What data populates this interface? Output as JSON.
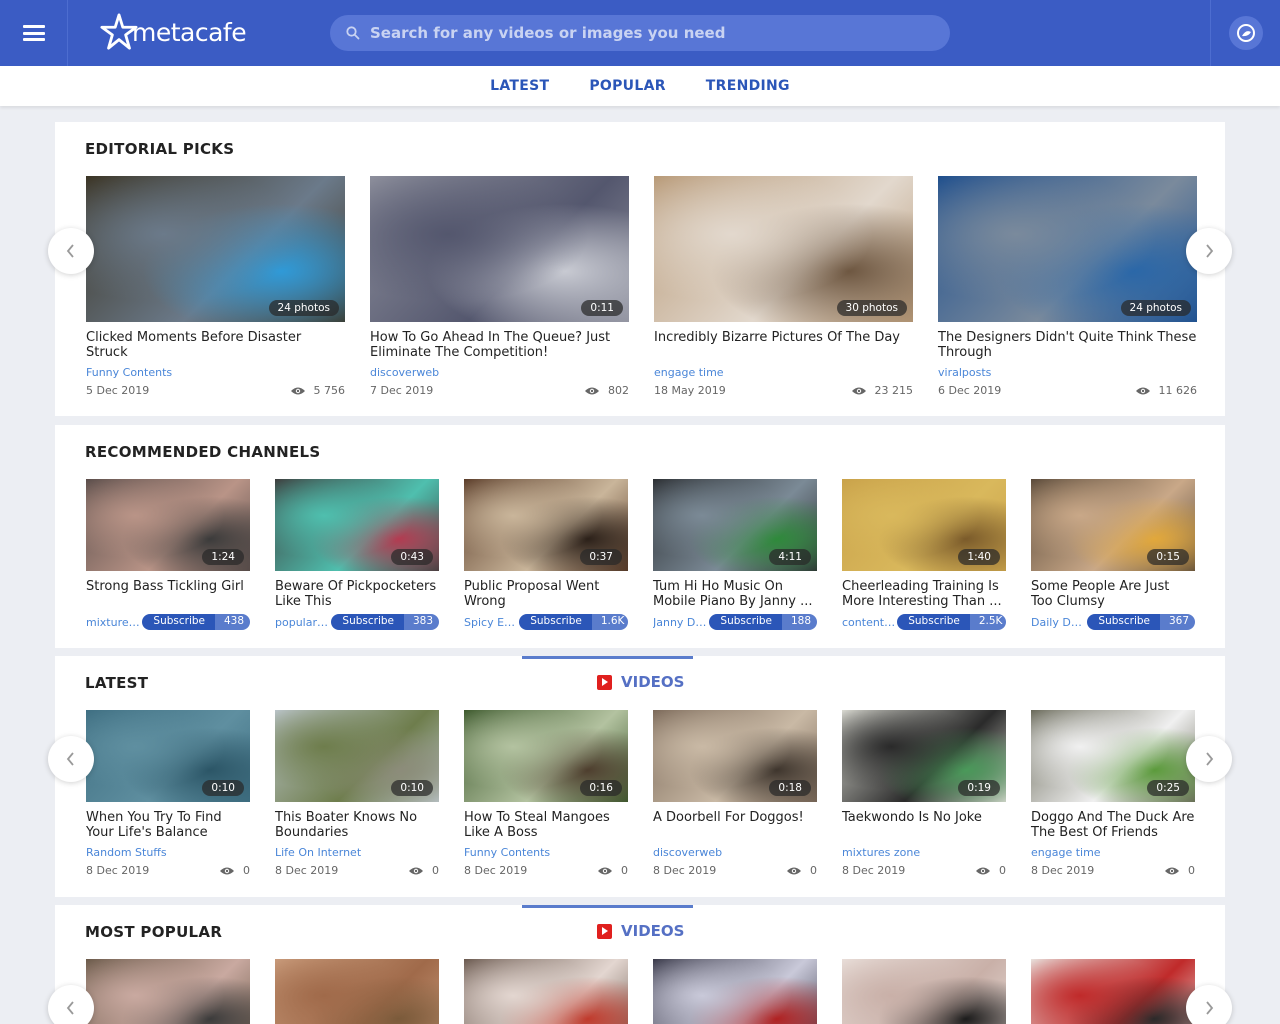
{
  "header": {
    "logo_text": "metacafe",
    "search_placeholder": "Search for any videos or images you need"
  },
  "nav": {
    "items": [
      "LATEST",
      "POPULAR",
      "TRENDING"
    ]
  },
  "editorial": {
    "title": "EDITORIAL PICKS",
    "items": [
      {
        "title": "Clicked Moments Before Disaster Struck",
        "channel": "Funny Contents",
        "date": "5 Dec 2019",
        "views": "5 756",
        "badge": "24 photos",
        "colors": [
          "#3b3424",
          "#6b7a8a",
          "#2f9ad8"
        ]
      },
      {
        "title": "How To Go Ahead In The Queue? Just Eliminate The Competition!",
        "channel": "discoverweb",
        "date": "7 Dec 2019",
        "views": "802",
        "badge": "0:11",
        "colors": [
          "#8d8f9c",
          "#54576e",
          "#c9cbd3"
        ]
      },
      {
        "title": "Incredibly Bizarre Pictures Of The Day",
        "channel": "engage time",
        "date": "18 May 2019",
        "views": "23 215",
        "badge": "30 photos",
        "colors": [
          "#b89a78",
          "#e2d8cd",
          "#6d5640"
        ]
      },
      {
        "title": "The Designers Didn't Quite Think These Through",
        "channel": "viralposts",
        "date": "6 Dec 2019",
        "views": "11 626",
        "badge": "24 photos",
        "colors": [
          "#1f4f8d",
          "#7a8a9c",
          "#2a67a8"
        ]
      }
    ]
  },
  "channels": {
    "title": "RECOMMENDED CHANNELS",
    "subscribe_label": "Subscribe",
    "items": [
      {
        "title": "Strong Bass Tickling Girl",
        "channel": "mixtures zone",
        "count": "438",
        "badge": "1:24",
        "colors": [
          "#5a4d4a",
          "#b99487",
          "#3a3a3a"
        ]
      },
      {
        "title": "Beware Of Pickpocketers Like This",
        "channel": "popular videos",
        "count": "383",
        "badge": "0:43",
        "colors": [
          "#3e3e3e",
          "#4fbfae",
          "#b43a50"
        ]
      },
      {
        "title": "Public Proposal Went Wrong",
        "channel": "Spicy Entertainment",
        "count": "1.6K",
        "badge": "0:37",
        "colors": [
          "#5b3d2a",
          "#c9b59a",
          "#2a1f18"
        ]
      },
      {
        "title": "Tum Hi Ho Music On Mobile Piano By Janny ...",
        "channel": "Janny Dolly",
        "count": "188",
        "badge": "4:11",
        "colors": [
          "#2c2f33",
          "#7b8a96",
          "#2e8a3a"
        ]
      },
      {
        "title": "Cheerleading Training Is More Interesting Than ...",
        "channel": "content zone",
        "count": "2.5K",
        "badge": "1:40",
        "colors": [
          "#c9a24a",
          "#d9b85c",
          "#7a5a2a"
        ]
      },
      {
        "title": "Some People Are Just Too Clumsy",
        "channel": "Daily Dose",
        "count": "367",
        "badge": "0:15",
        "colors": [
          "#5a4a3a",
          "#c9a888",
          "#e2a83a"
        ]
      }
    ]
  },
  "latest": {
    "title": "LATEST",
    "tab_label": "VIDEOS",
    "items": [
      {
        "title": "When You Try To Find Your Life's Balance",
        "channel": "Random Stuffs",
        "date": "8 Dec 2019",
        "views": "0",
        "badge": "0:10",
        "colors": [
          "#3f6f82",
          "#5f8fa0",
          "#2b5566"
        ]
      },
      {
        "title": "This Boater Knows No Boundaries",
        "channel": "Life On Internet",
        "date": "8 Dec 2019",
        "views": "0",
        "badge": "0:10",
        "colors": [
          "#b9c3c7",
          "#6e7d4c",
          "#8c8c7a"
        ]
      },
      {
        "title": "How To Steal Mangoes Like A Boss",
        "channel": "Funny Contents",
        "date": "8 Dec 2019",
        "views": "0",
        "badge": "0:16",
        "colors": [
          "#3e5a2e",
          "#b3c2a0",
          "#4d3d2d"
        ]
      },
      {
        "title": "A Doorbell For Doggos!",
        "channel": "discoverweb",
        "date": "8 Dec 2019",
        "views": "0",
        "badge": "0:18",
        "colors": [
          "#7c6a5a",
          "#c9b9a5",
          "#3d342c"
        ]
      },
      {
        "title": "Taekwondo Is No Joke",
        "channel": "mixtures zone",
        "date": "8 Dec 2019",
        "views": "0",
        "badge": "0:19",
        "colors": [
          "#d8d8d0",
          "#2a2a2a",
          "#4a9a5a"
        ]
      },
      {
        "title": "Doggo And The Duck Are The Best Of Friends",
        "channel": "engage time",
        "date": "8 Dec 2019",
        "views": "0",
        "badge": "0:25",
        "colors": [
          "#6a6a5a",
          "#f0f0f0",
          "#5a9a3a"
        ]
      }
    ]
  },
  "popular": {
    "title": "MOST POPULAR",
    "tab_label": "VIDEOS",
    "items": [
      {
        "colors": [
          "#6b5a4a",
          "#c9a9a0",
          "#3a3a3a"
        ]
      },
      {
        "colors": [
          "#c89a7a",
          "#a06a4a",
          "#7a5a3a"
        ]
      },
      {
        "colors": [
          "#6b5a50",
          "#e3d6d0",
          "#c0392b"
        ]
      },
      {
        "colors": [
          "#3a3a4a",
          "#c9c9d9",
          "#b02020"
        ]
      },
      {
        "colors": [
          "#e8ddd8",
          "#c9b0a8",
          "#1a1a1a"
        ]
      },
      {
        "colors": [
          "#e8e0dc",
          "#c02a2a",
          "#2a2a2a"
        ]
      }
    ]
  }
}
